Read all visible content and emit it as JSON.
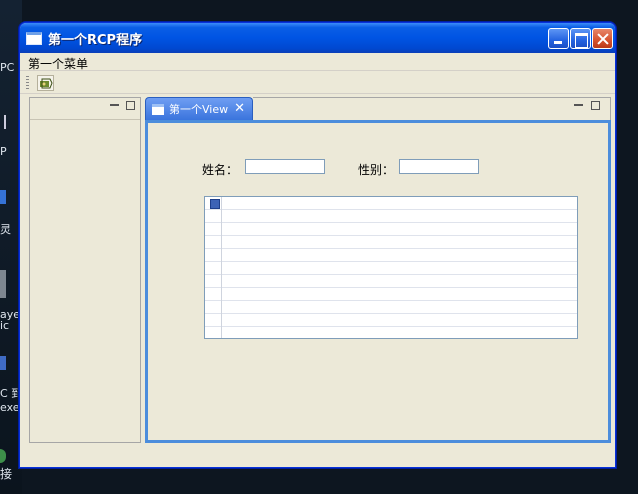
{
  "window": {
    "title": "第一个RCP程序"
  },
  "menubar": {
    "items": [
      {
        "label": "第一个菜单"
      }
    ]
  },
  "toolbar": {
    "buttons": [
      {
        "icon": "action-icon"
      }
    ]
  },
  "view": {
    "tab_label": "第一个View",
    "form": {
      "name_label": "姓名：",
      "name_value": "",
      "gender_label": "性别：",
      "gender_value": ""
    }
  },
  "desktop": {
    "labels": [
      "PC",
      "P",
      "灵",
      "aye",
      "ic",
      "C 到",
      "exe",
      "接"
    ]
  },
  "colors": {
    "titlebar": "#0054e3",
    "window_bg": "#ece9d8",
    "active_view_border": "#4c8ddc",
    "close_button": "#d6522e"
  }
}
